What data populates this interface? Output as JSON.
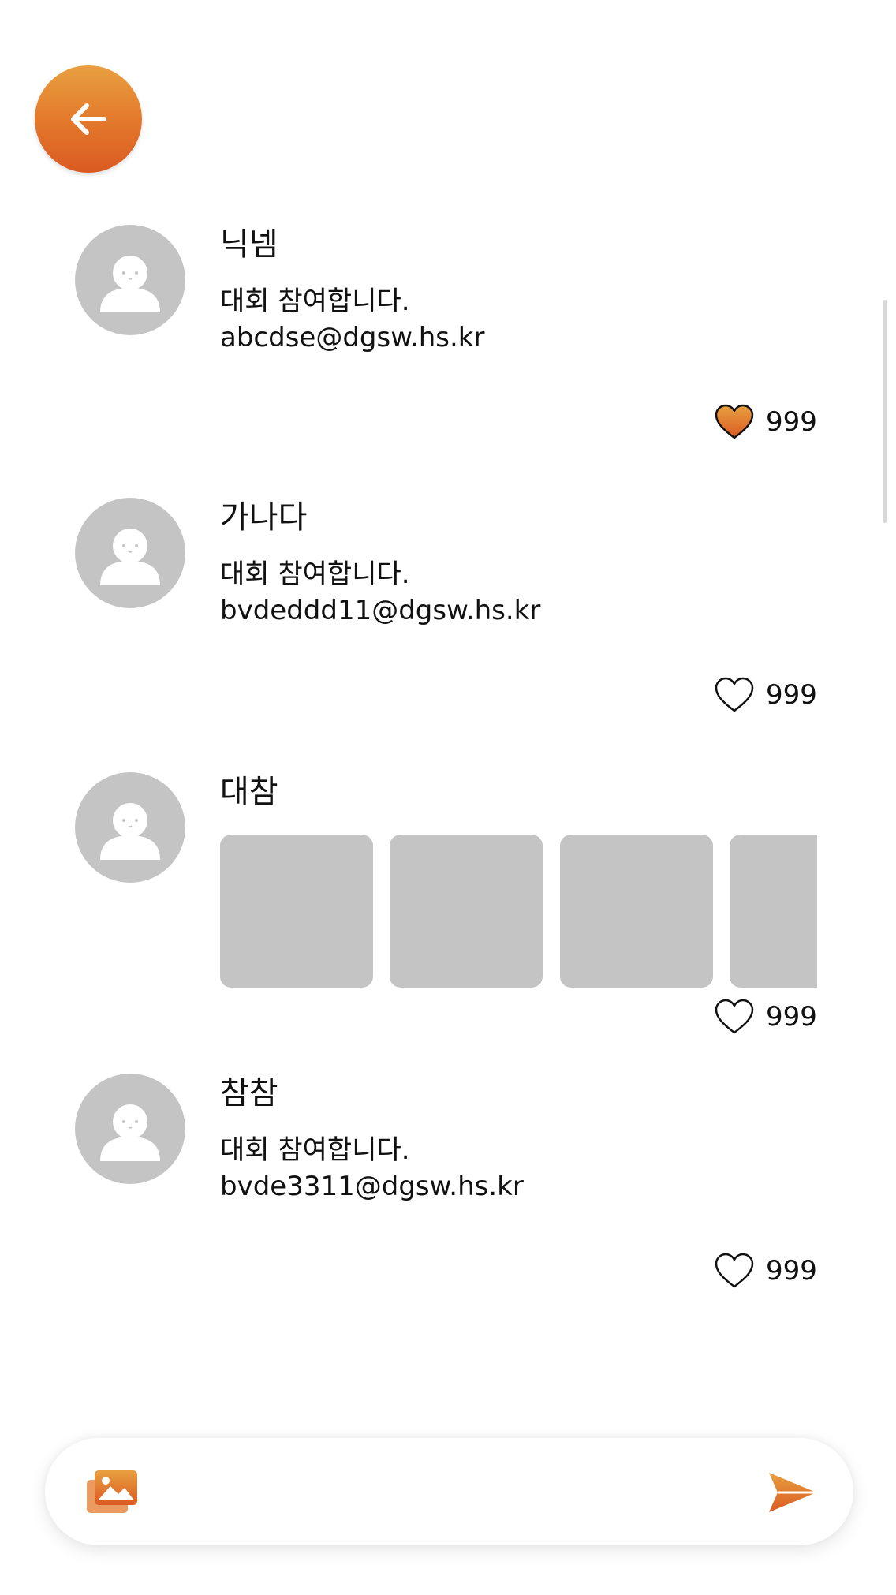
{
  "colors": {
    "accent_top": "#E8A040",
    "accent_bottom": "#DA5A22",
    "placeholder_gray": "#C4C4C4",
    "text": "#111111"
  },
  "header": {
    "back_icon": "arrow-left-icon"
  },
  "posts": [
    {
      "nickname": "닉넴",
      "text_line1": "대회 참여합니다.",
      "text_line2": "abcdse@dgsw.hs.kr",
      "likes": "999",
      "liked": true
    },
    {
      "nickname": "가나다",
      "text_line1": "대회 참여합니다.",
      "text_line2": "bvdeddd11@dgsw.hs.kr",
      "likes": "999",
      "liked": false
    },
    {
      "nickname": "대참",
      "images_shown": 4,
      "likes": "999",
      "liked": false
    },
    {
      "nickname": "참참",
      "text_line1": "대회 참여합니다.",
      "text_line2": "bvde3311@dgsw.hs.kr",
      "likes": "999",
      "liked": false
    }
  ],
  "composer": {
    "input_value": "",
    "attach_icon": "image-gallery-icon",
    "send_icon": "send-icon"
  }
}
